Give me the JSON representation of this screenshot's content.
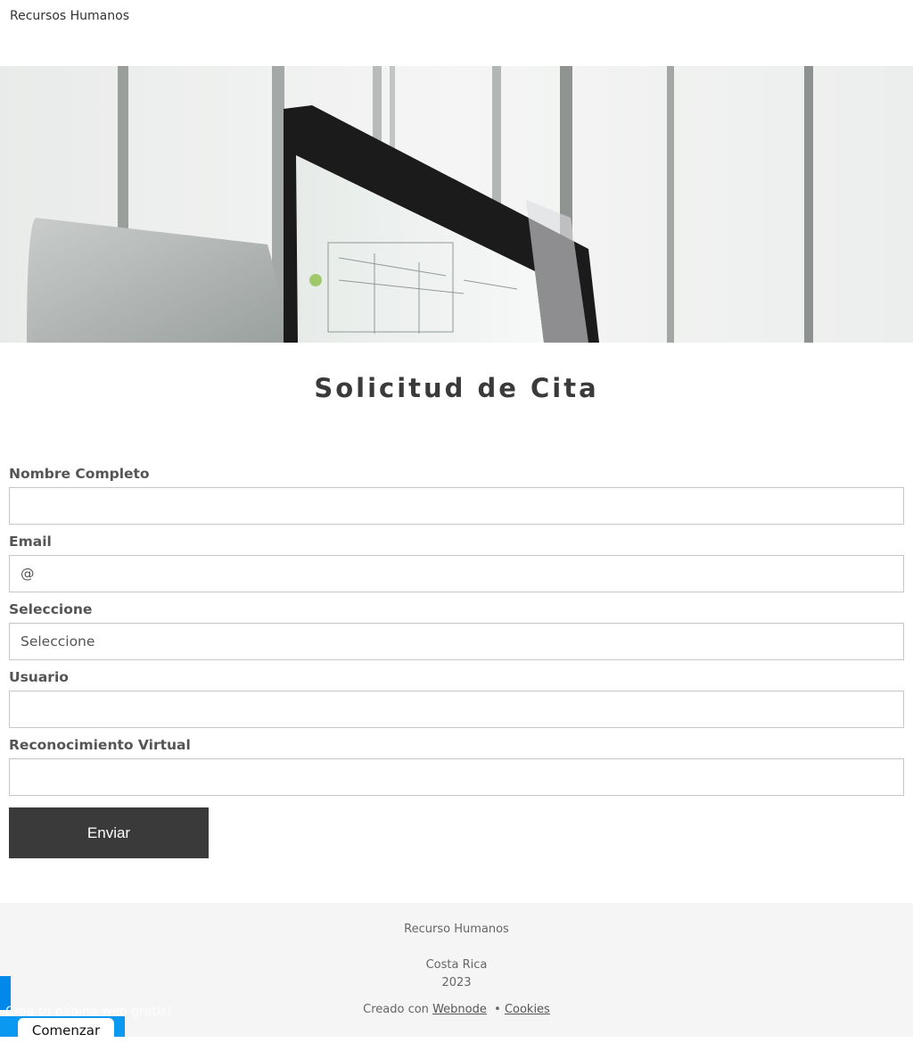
{
  "header": {
    "site_title": "Recursos Humanos"
  },
  "hero": {
    "image": "office-laptop-photo"
  },
  "main": {
    "heading": "Solicitud de Cita"
  },
  "form": {
    "fields": [
      {
        "label": "Nombre Completo",
        "value": ""
      },
      {
        "label": "Email",
        "value": "@"
      },
      {
        "label": "Seleccione",
        "value": "Seleccione"
      },
      {
        "label": "Usuario",
        "value": ""
      },
      {
        "label": "Reconocimiento Virtual",
        "value": ""
      }
    ],
    "submit_label": "Enviar"
  },
  "footer": {
    "company": "Recurso Humanos",
    "country": "Costa Rica",
    "year": "2023",
    "created_with": "Creado con",
    "webnode_link": "Webnode",
    "separator": "•",
    "cookies_link": "Cookies"
  },
  "promo": {
    "text": "Crea tu página web gratis!",
    "button_label": "Comenzar"
  },
  "colors": {
    "button_dark": "#3a3a3a",
    "promo_blue": "#0a98f0",
    "footer_bg": "#f5f5f5"
  }
}
